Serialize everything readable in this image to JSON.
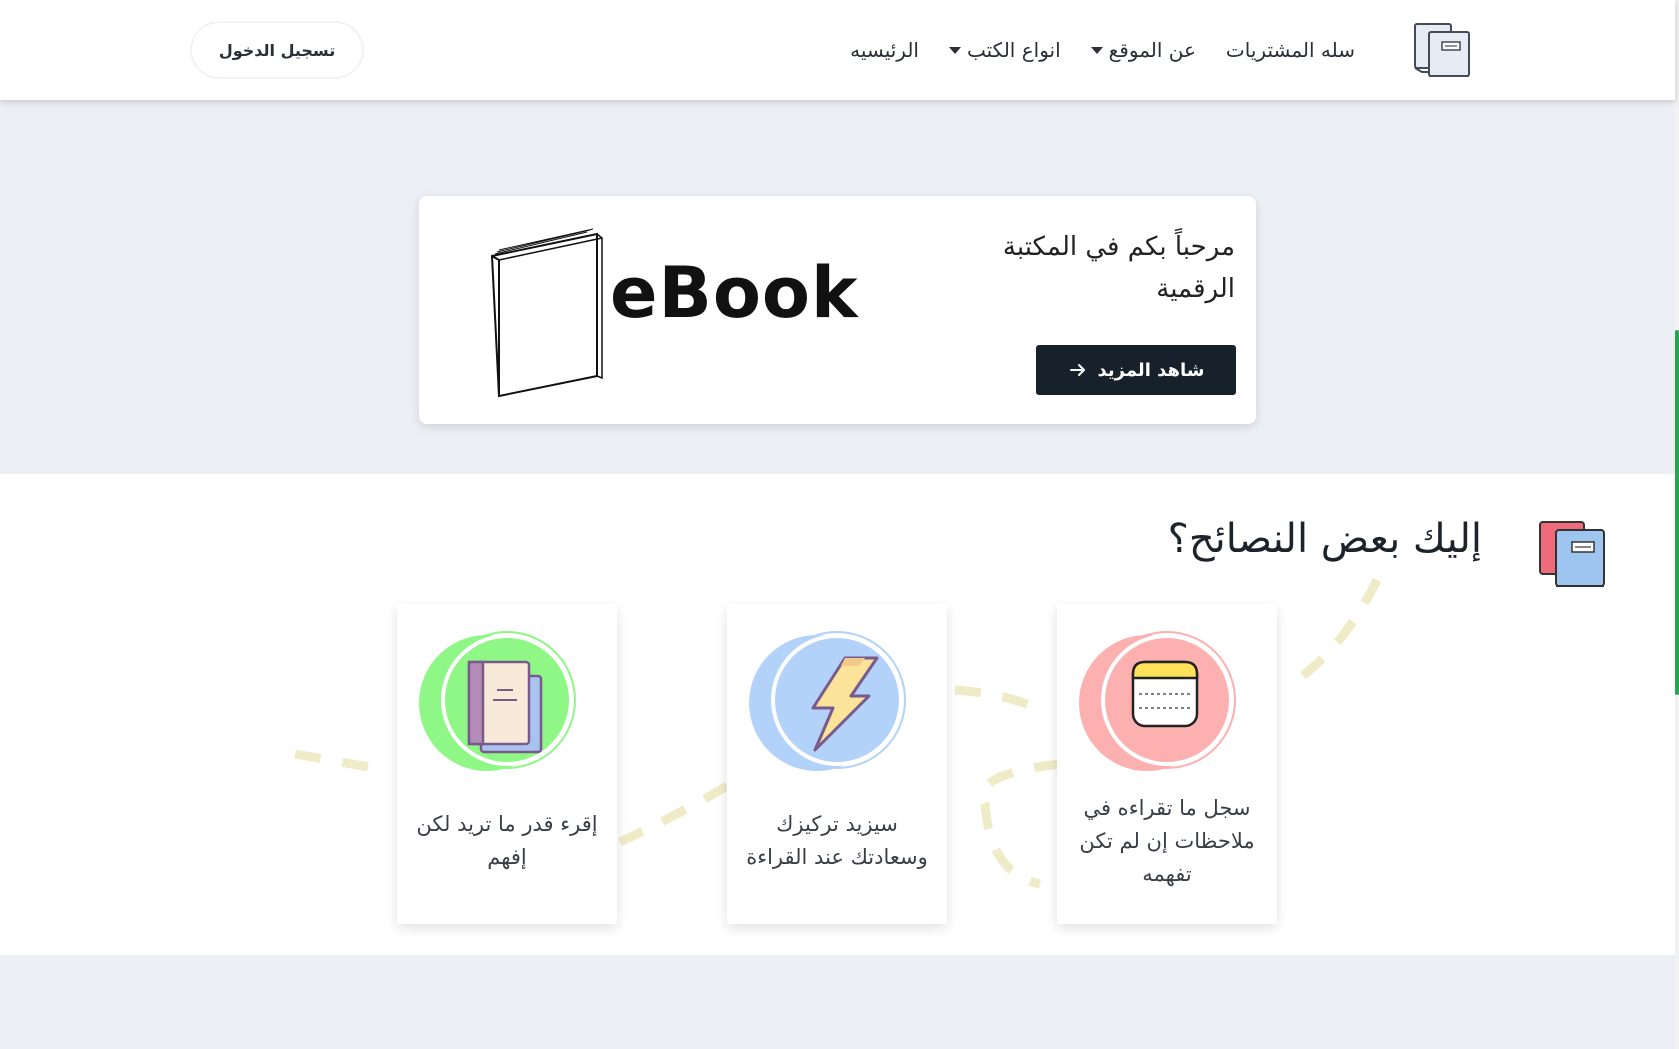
{
  "navbar": {
    "logo_icon": "books-icon",
    "links": [
      {
        "label": "الرئيسيه",
        "dropdown": false
      },
      {
        "label": "انواع الكتب",
        "dropdown": true
      },
      {
        "label": "عن الموقع",
        "dropdown": true
      },
      {
        "label": "سله المشتريات",
        "dropdown": false
      }
    ],
    "login_label": "تسجيل الدخول"
  },
  "hero": {
    "title": "مرحباً بكم في المكتبة الرقمية",
    "button_label": "شاهد المزيد",
    "button_icon": "arrow-right-icon",
    "brand_text": "eBook"
  },
  "tips": {
    "title": "إليك بعض النصائح؟",
    "cards": [
      {
        "text": "سجل ما تقراءه في ملاحظات إن لم تكن تفهمه",
        "icon": "notes-icon",
        "color": "#fcb0b0"
      },
      {
        "text": "سيزيد تركيزك وسعادتك عند القراءة",
        "icon": "lightning-icon",
        "color": "#b3d2f9"
      },
      {
        "text": "إقرء قدر ما تريد لكن إفهم",
        "icon": "notebook-icon",
        "color": "#8ef785"
      }
    ]
  },
  "colors": {
    "dark_button": "#17212b",
    "page_bg": "#ecf0f4",
    "path_dash": "#efebc7",
    "scroll_thumb": "#2aa44f"
  }
}
